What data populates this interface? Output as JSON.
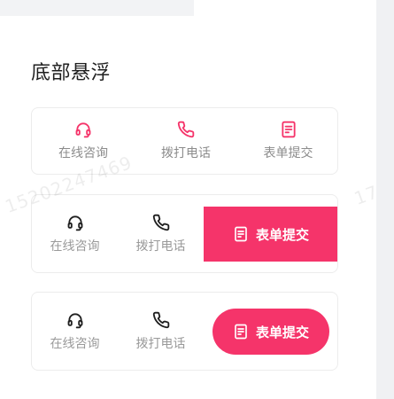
{
  "section": {
    "title": "底部悬浮"
  },
  "card1": {
    "items": [
      {
        "label": "在线咨询",
        "icon": "headset-icon"
      },
      {
        "label": "拨打电话",
        "icon": "phone-icon"
      },
      {
        "label": "表单提交",
        "icon": "form-icon"
      }
    ]
  },
  "card2": {
    "items": [
      {
        "label": "在线咨询",
        "icon": "headset-icon"
      },
      {
        "label": "拨打电话",
        "icon": "phone-icon"
      }
    ],
    "button": {
      "label": "表单提交",
      "icon": "form-icon"
    }
  },
  "card3": {
    "items": [
      {
        "label": "在线咨询",
        "icon": "headset-icon"
      },
      {
        "label": "拨打电话",
        "icon": "phone-icon"
      }
    ],
    "button": {
      "label": "表单提交",
      "icon": "form-icon"
    }
  },
  "watermark": {
    "text1": "15202247469",
    "text2": "17"
  },
  "colors": {
    "accent": "#f5346a",
    "icon_dark": "#1f1f1f",
    "label_gray": "#8c8c8c"
  }
}
